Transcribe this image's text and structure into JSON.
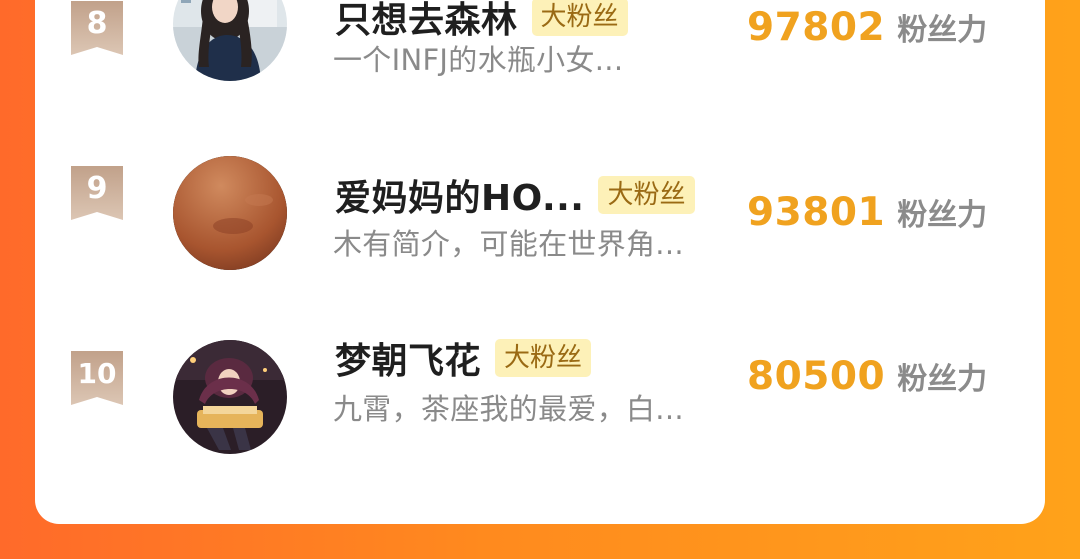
{
  "ranking": {
    "rows": [
      {
        "rank": "8",
        "name": "只想去森林",
        "tag": "大粉丝",
        "bio": "一个INFJ的水瓶小女...",
        "score": "97802",
        "unit": "粉丝力"
      },
      {
        "rank": "9",
        "name": "爱妈妈的HO...",
        "tag": "大粉丝",
        "bio": "木有简介，可能在世界角...",
        "score": "93801",
        "unit": "粉丝力"
      },
      {
        "rank": "10",
        "name": "梦朝飞花",
        "tag": "大粉丝",
        "bio": "九霄，茶座我的最爱，白...",
        "score": "80500",
        "unit": "粉丝力"
      }
    ]
  },
  "colors": {
    "accent": "#f0a21f",
    "tag_bg": "#fdf1b8",
    "tag_text": "#9a6a14",
    "rank_badge": "#c9ac97",
    "background_gradient": [
      "#ff6a2a",
      "#ffa21a"
    ]
  }
}
